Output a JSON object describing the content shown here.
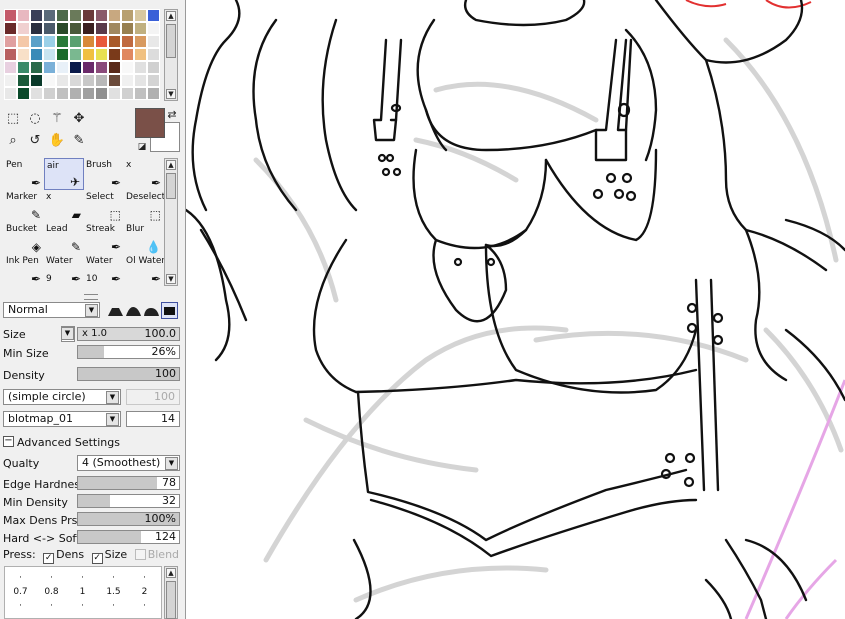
{
  "palette": {
    "swatches": [
      "#c45a6a",
      "#e8b8c0",
      "#3a3f58",
      "#5a6a7a",
      "#4c6a4a",
      "#6a7a5a",
      "#6a3a3a",
      "#8a5a6a",
      "#c8a880",
      "#b8a070",
      "#d8c8a0",
      "#3a60d8",
      "#6a2a2a",
      "#f0d0d0",
      "#2a2f40",
      "#4a5a6a",
      "#2a4a2a",
      "#4a5a3a",
      "#3a2020",
      "#5a3a4a",
      "#a08860",
      "#988050",
      "#c0b080",
      "#f4f4f4",
      "#e0a0a0",
      "#f4c8a8",
      "#5aa0c8",
      "#9ad0e8",
      "#2a7a3a",
      "#5aa070",
      "#d88a3a",
      "#e85a3a",
      "#a85a2a",
      "#c06a40",
      "#d89a60",
      "#e8e8e8",
      "#b86060",
      "#f8e0c8",
      "#3a8ab8",
      "#c8e4f0",
      "#1a6a2a",
      "#7ab890",
      "#f0c040",
      "#e8e050",
      "#7a3a1a",
      "#e08860",
      "#f0c080",
      "#dcdcdc",
      "#e8d0e0",
      "#3a8a6a",
      "#2a6a4a",
      "#7ab0d8",
      "#e8f0f8",
      "#0a1a4a",
      "#6a2a6a",
      "#8a4a7a",
      "#5a2a1a",
      "#f8f8f8",
      "#e0e0e0",
      "#d0d0d0",
      "#f0f0f0",
      "#1a5a3a",
      "#0a3a2a",
      "#f8f8f8",
      "#e8e8e8",
      "#d8d8d8",
      "#c8c8c8",
      "#b8b8b8",
      "#6a4a3a",
      "#f0f0f0",
      "#e4e4e4",
      "#d4d4d4",
      "#e8e8e8",
      "#0a4a2a",
      "#e0e0e0",
      "#d0d0d0",
      "#c0c0c0",
      "#b0b0b0",
      "#a0a0a0",
      "#909090",
      "#e0e0e0",
      "#d0d0d0",
      "#c0c0c0",
      "#b0b0b0"
    ]
  },
  "colors": {
    "primary": "#7a5048",
    "secondary": "#ffffff"
  },
  "toolbar": {
    "icons": [
      "rect-select-icon",
      "lasso-icon",
      "magic-wand-icon",
      "move-icon",
      "zoom-icon",
      "rotate-icon",
      "hand-icon",
      "eyedropper-icon"
    ],
    "glyphs": [
      "⬚",
      "◌",
      "⚚",
      "✥",
      "⌕",
      "↺",
      "✋",
      "✎"
    ]
  },
  "tools": [
    {
      "name": "Pen",
      "size": "",
      "glyph": "✒"
    },
    {
      "name": "air",
      "size": "",
      "glyph": "✈"
    },
    {
      "name": "Brush",
      "size": "",
      "glyph": "✒"
    },
    {
      "name": "x",
      "size": "",
      "glyph": "✒"
    },
    {
      "name": "Marker",
      "size": "",
      "glyph": "✎"
    },
    {
      "name": "x",
      "size": "",
      "glyph": "▰"
    },
    {
      "name": "Select",
      "size": "",
      "glyph": "⬚"
    },
    {
      "name": "Deselect",
      "size": "",
      "glyph": "⬚"
    },
    {
      "name": "Bucket",
      "size": "",
      "glyph": "◈"
    },
    {
      "name": "Lead",
      "size": "",
      "glyph": "✎"
    },
    {
      "name": "Streak",
      "size": "",
      "glyph": "✒"
    },
    {
      "name": "Blur",
      "size": "",
      "glyph": "💧"
    },
    {
      "name": "Ink Pen",
      "size": "",
      "glyph": "✒"
    },
    {
      "name": "Water",
      "size": "9",
      "glyph": "✒"
    },
    {
      "name": "Water",
      "size": "10",
      "glyph": "✒"
    },
    {
      "name": "Ol Water",
      "size": "",
      "glyph": "✒"
    }
  ],
  "blend_mode": "Normal",
  "settings": {
    "size_label": "Size",
    "size_mult": "x 1.0",
    "size_value": "100.0",
    "min_size_label": "Min Size",
    "min_size_value": "26%",
    "min_size_fill": 0.26,
    "density_label": "Density",
    "density_value": "100",
    "density_fill": 1.0,
    "shape": "(simple circle)",
    "shape_value": "100",
    "texture": "blotmap_01",
    "texture_value": "14",
    "advanced_label": "Advanced Settings",
    "quality_label": "Qualty",
    "quality_value": "4 (Smoothest)",
    "edge_label": "Edge Hardness",
    "edge_value": "78",
    "edge_fill": 0.78,
    "min_density_label": "Min Density",
    "min_density_value": "32",
    "min_density_fill": 0.32,
    "max_dens_label": "Max Dens Prs.",
    "max_dens_value": "100%",
    "max_dens_fill": 1.0,
    "hard_soft_label": "Hard <-> Soft",
    "hard_soft_value": "124",
    "hard_soft_fill": 0.62,
    "press_label": "Press:",
    "press_dens": "Dens",
    "press_size": "Size",
    "press_blend": "Blend"
  },
  "brush_sizes": [
    "0.7",
    "0.8",
    "1",
    "1.5",
    "2"
  ]
}
